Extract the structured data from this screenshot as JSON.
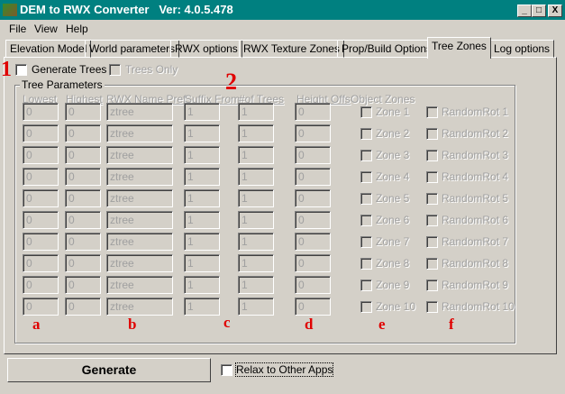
{
  "window": {
    "title": "DEM to RWX Converter   Ver: 4.0.5.478",
    "minimize": "_",
    "maximize": "□",
    "close": "X"
  },
  "menu": [
    "File",
    "View",
    "Help"
  ],
  "tabs": [
    "Elevation Model",
    "World parameters",
    "RWX options",
    "RWX Texture Zones",
    "Prop/Build Options",
    "Tree Zones",
    "Log options"
  ],
  "active_tab": "Tree Zones",
  "generate_trees": {
    "label": "Generate Trees",
    "checked": false
  },
  "trees_only": {
    "label": "Trees Only",
    "checked": false,
    "disabled": true
  },
  "group_title": "Tree Parameters",
  "headers": {
    "lowest": "Lowest",
    "highest": "Highest",
    "rwx": "RWX Name Pref.",
    "suffix": "Suffix From",
    "trees": "#of Trees",
    "height": "Height Offs",
    "zones": "Object Zones"
  },
  "rows": [
    {
      "lowest": "0",
      "highest": "0",
      "rwx": "ztree",
      "suffix": "1",
      "trees": "1",
      "height": "0",
      "zone": "Zone 1",
      "rot": "RandomRot 1"
    },
    {
      "lowest": "0",
      "highest": "0",
      "rwx": "ztree",
      "suffix": "1",
      "trees": "1",
      "height": "0",
      "zone": "Zone 2",
      "rot": "RandomRot 2"
    },
    {
      "lowest": "0",
      "highest": "0",
      "rwx": "ztree",
      "suffix": "1",
      "trees": "1",
      "height": "0",
      "zone": "Zone 3",
      "rot": "RandomRot 3"
    },
    {
      "lowest": "0",
      "highest": "0",
      "rwx": "ztree",
      "suffix": "1",
      "trees": "1",
      "height": "0",
      "zone": "Zone 4",
      "rot": "RandomRot 4"
    },
    {
      "lowest": "0",
      "highest": "0",
      "rwx": "ztree",
      "suffix": "1",
      "trees": "1",
      "height": "0",
      "zone": "Zone 5",
      "rot": "RandomRot 5"
    },
    {
      "lowest": "0",
      "highest": "0",
      "rwx": "ztree",
      "suffix": "1",
      "trees": "1",
      "height": "0",
      "zone": "Zone 6",
      "rot": "RandomRot 6"
    },
    {
      "lowest": "0",
      "highest": "0",
      "rwx": "ztree",
      "suffix": "1",
      "trees": "1",
      "height": "0",
      "zone": "Zone 7",
      "rot": "RandomRot 7"
    },
    {
      "lowest": "0",
      "highest": "0",
      "rwx": "ztree",
      "suffix": "1",
      "trees": "1",
      "height": "0",
      "zone": "Zone 8",
      "rot": "RandomRot 8"
    },
    {
      "lowest": "0",
      "highest": "0",
      "rwx": "ztree",
      "suffix": "1",
      "trees": "1",
      "height": "0",
      "zone": "Zone 9",
      "rot": "RandomRot 9"
    },
    {
      "lowest": "0",
      "highest": "0",
      "rwx": "ztree",
      "suffix": "1",
      "trees": "1",
      "height": "0",
      "zone": "Zone 10",
      "rot": "RandomRot 10"
    }
  ],
  "annotations": {
    "n1": "1",
    "n2": "2",
    "a": "a",
    "b": "b",
    "c": "c",
    "d": "d",
    "e": "e",
    "f": "f"
  },
  "generate_button": "Generate",
  "relax": {
    "label": "Relax to Other Apps",
    "checked": false
  }
}
